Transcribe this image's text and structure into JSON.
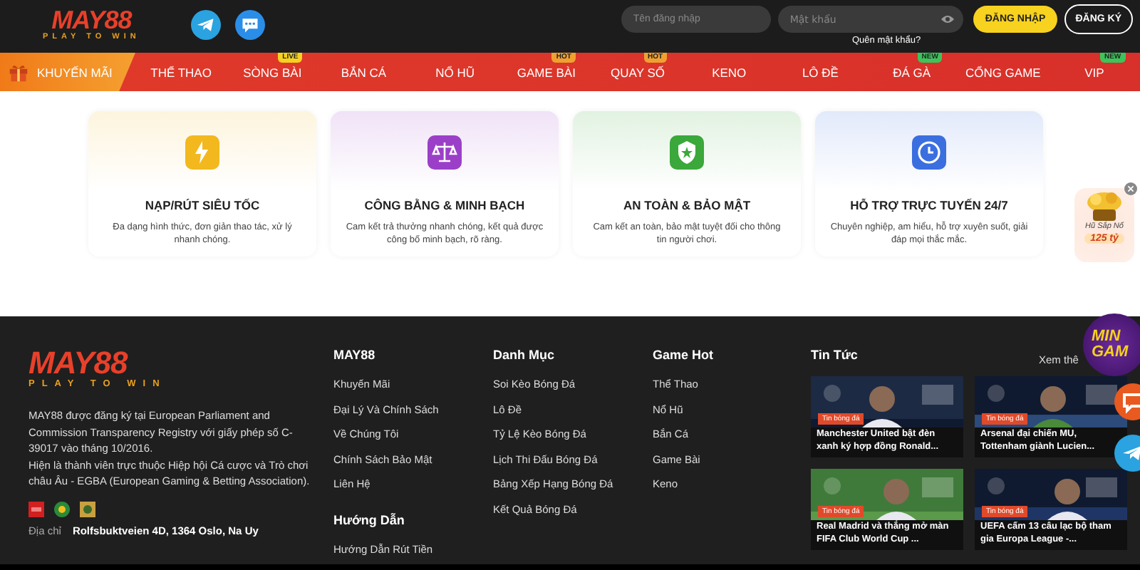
{
  "header": {
    "logo": {
      "name": "MAY88",
      "tagline": "PLAY TO WIN"
    },
    "username": {
      "placeholder": "Tên đăng nhập"
    },
    "password": {
      "placeholder": "Mật khẩu"
    },
    "forgot": "Quên mật khẩu?",
    "login": "ĐĂNG NHẬP",
    "register": "ĐĂNG KÝ"
  },
  "nav": [
    {
      "label": "KHUYẾN MÃI",
      "selected": true
    },
    {
      "label": "THỂ THAO",
      "selected": false
    },
    {
      "label": "SÒNG BÀI",
      "selected": false,
      "badge": {
        "text": "LIVE",
        "color": "#f5d21f"
      }
    },
    {
      "label": "BẮN CÁ",
      "selected": false
    },
    {
      "label": "NỔ HŨ",
      "selected": false
    },
    {
      "label": "GAME BÀI",
      "selected": false,
      "badge": {
        "text": "HOT",
        "color": "#f0a030"
      }
    },
    {
      "label": "QUAY SỐ",
      "selected": false,
      "badge": {
        "text": "HOT",
        "color": "#f0a030"
      }
    },
    {
      "label": "KENO",
      "selected": false
    },
    {
      "label": "LÔ ĐỀ",
      "selected": false
    },
    {
      "label": "ĐÁ GÀ",
      "selected": false,
      "badge": {
        "text": "NEW",
        "color": "#3cc45a"
      }
    },
    {
      "label": "CỔNG GAME",
      "selected": false
    },
    {
      "label": "VIP",
      "selected": false,
      "badge": {
        "text": "NEW",
        "color": "#3cc45a"
      }
    }
  ],
  "features": [
    {
      "kind": "bolt",
      "color": "#f2b81e",
      "title": "NẠP/RÚT SIÊU TỐC",
      "desc": "Đa dạng hình thức, đơn giản thao tác, xử lý nhanh chóng."
    },
    {
      "kind": "scales",
      "color": "#9b3fc8",
      "title": "CÔNG BẰNG & MINH BẠCH",
      "desc": "Cam kết trả thưởng nhanh chóng, kết quả được công bố minh bạch, rõ ràng."
    },
    {
      "kind": "shield",
      "color": "#3aa83a",
      "title": "AN TOÀN & BẢO MẬT",
      "desc": "Cam kết an toàn, bảo mật tuyệt đối cho thông tin người chơi."
    },
    {
      "kind": "clock",
      "color": "#3b6fe0",
      "title": "HỖ TRỢ TRỰC TUYẾN 24/7",
      "desc": "Chuyên nghiệp, am hiểu, hỗ trợ xuyên suốt, giải đáp mọi thắc mắc."
    }
  ],
  "jackpot": {
    "label": "Hũ Sắp Nổ",
    "amount": "125 tỷ"
  },
  "footer": {
    "logo": {
      "name": "MAY88",
      "tagline": "PLAY TO WIN"
    },
    "about": [
      "MAY88 được đăng ký tại European Parliament and Commission Transparency Registry với giấy phép số C-39017 vào tháng 10/2016.",
      "Hiện là thành viên trực thuộc Hiệp hội Cá cược và Trò chơi châu Âu - EGBA (European Gaming & Betting Association)."
    ],
    "address": {
      "label": "Địa chỉ",
      "value": "Rolfsbuktveien 4D, 1364 Oslo, Na Uy"
    },
    "columns": [
      {
        "sections": [
          {
            "title": "MAY88",
            "links": [
              "Khuyến Mãi",
              "Đại Lý Và Chính Sách",
              "Về Chúng Tôi",
              "Chính Sách Bảo Mật",
              "Liên Hệ"
            ]
          },
          {
            "title": "Hướng Dẫn",
            "links": [
              "Hướng Dẫn Rút Tiền"
            ]
          }
        ]
      },
      {
        "sections": [
          {
            "title": "Danh Mục",
            "links": [
              "Soi Kèo Bóng Đá",
              "Lô Đề",
              "Tỷ Lệ Kèo Bóng Đá",
              "Lịch Thi Đấu Bóng Đá",
              "Bảng Xếp Hạng Bóng Đá",
              "Kết Quả Bóng Đá"
            ]
          }
        ]
      },
      {
        "sections": [
          {
            "title": "Game Hot",
            "links": [
              "Thể Thao",
              "Nổ Hũ",
              "Bắn Cá",
              "Game Bài",
              "Keno"
            ]
          }
        ]
      }
    ],
    "news": {
      "title": "Tin Tức",
      "more": "Xem thê",
      "items": [
        {
          "tag": "Tin bóng đá",
          "title": "Manchester United bật đèn xanh ký hợp đồng Ronald..."
        },
        {
          "tag": "Tin bóng đá",
          "title": "Arsenal đại chiến MU, Tottenham giành Lucien..."
        },
        {
          "tag": "Tin bóng đá",
          "title": "Real Madrid và thắng mở màn FIFA Club World Cup ..."
        },
        {
          "tag": "Tin bóng đá",
          "title": "UEFA cấm 13 câu lạc bộ tham gia Europa League -..."
        }
      ]
    }
  },
  "mini_game": {
    "lines": [
      "MIN",
      "GAM"
    ]
  }
}
